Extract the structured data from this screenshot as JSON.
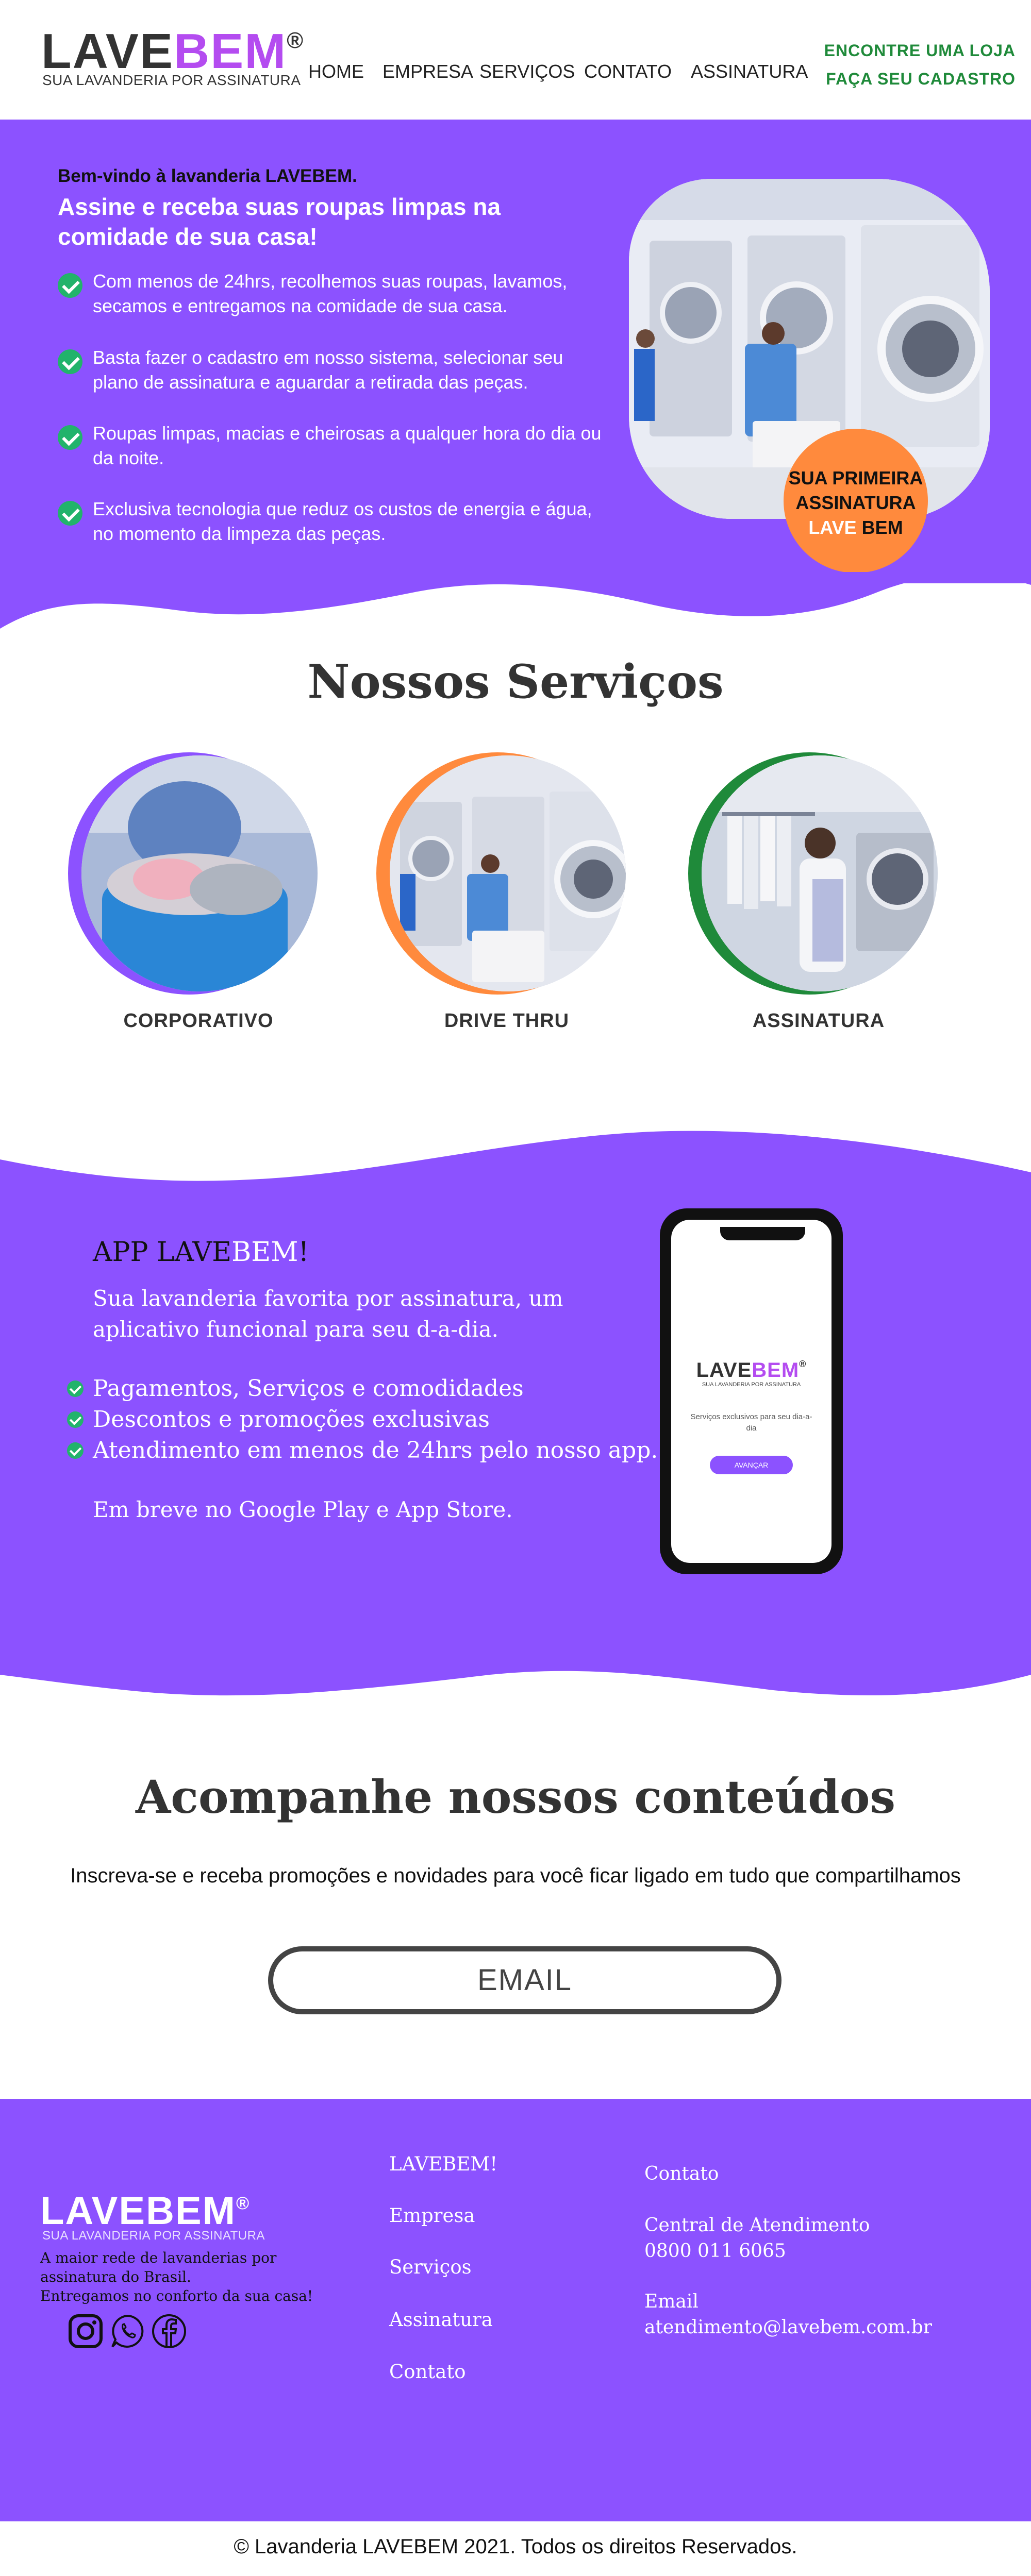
{
  "header": {
    "logo_lave": "LAVE",
    "logo_bem": "BEM",
    "logo_reg": "®",
    "logo_sub": "SUA LAVANDERIA POR ASSINATURA",
    "nav": [
      "HOME",
      "EMPRESA",
      "SERVIÇOS",
      "CONTATO",
      "ASSINATURA"
    ],
    "cta_store": "ENCONTRE UMA LOJA",
    "cta_register": "FAÇA SEU CADASTRO"
  },
  "hero": {
    "kicker": "Bem-vindo à lavanderia LAVEBEM.",
    "title": "Assine e receba suas roupas limpas na comidade de sua casa!",
    "bullets": [
      "Com menos de 24hrs, recolhemos suas roupas, lavamos, secamos e entregamos na comidade de sua casa.",
      "Basta fazer o cadastro em nosso sistema, selecionar seu plano de assinatura e aguardar a retirada das peças.",
      "Roupas limpas, macias e cheirosas a qualquer hora do dia ou da noite.",
      "Exclusiva tecnologia que reduz os custos de energia e água, no momento da limpeza das peças."
    ],
    "badge_line1": "SUA PRIMEIRA",
    "badge_line2": "ASSINATURA",
    "badge_lave": "LAVE",
    "badge_bem": "BEM"
  },
  "services": {
    "title": "Nossos Serviços",
    "items": [
      {
        "label": "CORPORATIVO",
        "ring_color": "#8c52ff"
      },
      {
        "label": "DRIVE THRU",
        "ring_color": "#ff8a3d"
      },
      {
        "label": "ASSINATURA",
        "ring_color": "#1f8a3a"
      }
    ]
  },
  "app": {
    "title_prefix": "APP LAVE",
    "title_bem": "BEM",
    "title_suffix": "!",
    "description": "Sua lavanderia favorita por assinatura, um aplicativo funcional para seu d-a-dia.",
    "features": [
      "Pagamentos, Serviços e comodidades",
      "Descontos e promoções exclusivas",
      "Atendimento em menos de 24hrs pelo nosso app."
    ],
    "note": "Em breve no Google Play e App Store.",
    "phone": {
      "logo_lave": "LAVE",
      "logo_bem": "BEM",
      "logo_reg": "®",
      "logo_sub": "SUA LAVANDERIA POR ASSINATURA",
      "text": "Serviços exclusivos para seu dia-a-dia",
      "button": "AVANÇAR"
    }
  },
  "newsletter": {
    "title": "Acompanhe nossos conteúdos",
    "subtitle": "Inscreva-se e receba promoções e novidades para você ficar ligado em tudo que compartilhamos",
    "email_label": "EMAIL"
  },
  "footer": {
    "logo_lave": "LAVE",
    "logo_bem": "BEM",
    "logo_reg": "®",
    "logo_sub": "SUA LAVANDERIA POR ASSINATURA",
    "tagline_1": "A maior rede de lavanderias por",
    "tagline_2": "assinatura do Brasil.",
    "tagline_3": "Entregamos no conforto da sua casa!",
    "social": [
      "instagram-icon",
      "whatsapp-icon",
      "facebook-icon"
    ],
    "links": [
      "LAVEBEM!",
      "Empresa",
      "Serviços",
      "Assinatura",
      "Contato"
    ],
    "contact_heading": "Contato",
    "support_label": "Central de Atendimento",
    "support_phone": "0800 011 6065",
    "email_label": "Email",
    "email_value": "atendimento@lavebem.com.br"
  },
  "copyright": "© Lavanderia LAVEBEM 2021. Todos os direitos Reservados.",
  "colors": {
    "brand_purple": "#8c52ff",
    "logo_purple": "#b44cf0",
    "accent_orange": "#ff8a3d",
    "cta_green": "#1f8a3a",
    "check_green": "#22b36b"
  }
}
